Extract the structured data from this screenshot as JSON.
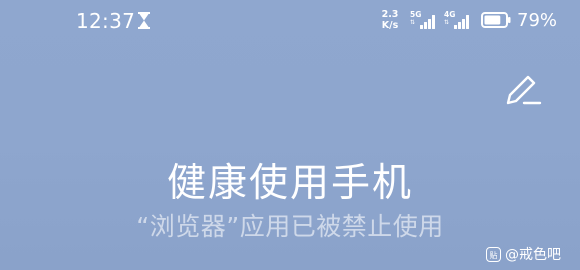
{
  "status_bar": {
    "time": "12:37",
    "net_speed_value": "2.3",
    "net_speed_unit": "K/s",
    "signal_1_label": "5G",
    "signal_2_label": "4G",
    "battery_percent": "79%",
    "battery_level": 0.79
  },
  "main": {
    "title": "健康使用手机",
    "subtitle": "“浏览器”应用已被禁止使用"
  },
  "watermark": {
    "text": "@戒色吧",
    "logo_glyph": "贴"
  },
  "icons": {
    "hourglass": "hourglass-icon",
    "edit": "pencil-edit-icon",
    "battery": "battery-icon",
    "signal": "cell-signal-icon"
  }
}
